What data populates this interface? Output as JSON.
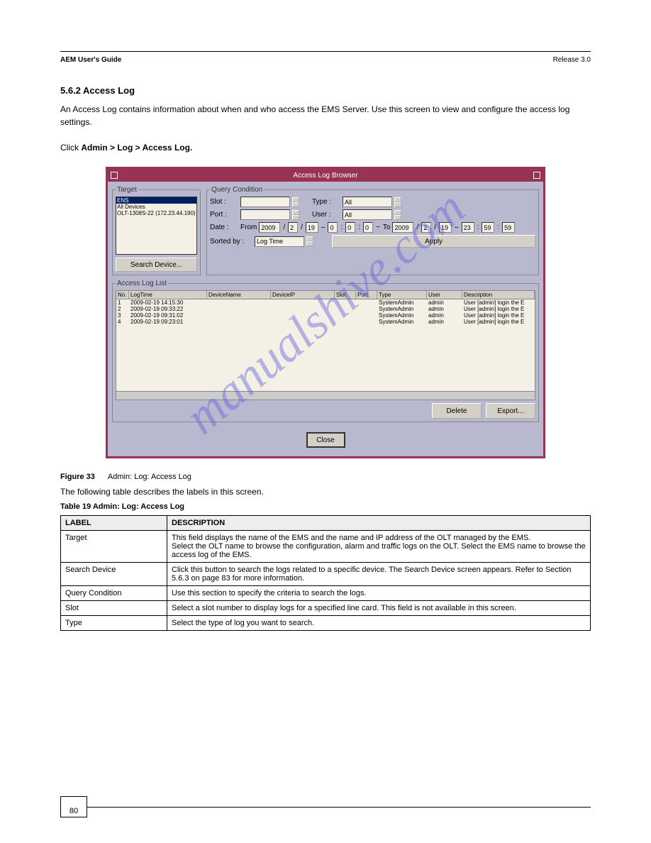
{
  "header": {
    "left": "AEM User's Guide",
    "right": "Release 3.0"
  },
  "section_title": "5.6.2 Access Log",
  "intro": "An Access Log contains information about when and who access the EMS Server. Use this screen to view and configure the access log settings.",
  "pathline_label": "Click ",
  "pathline_value": "Admin > Log > Access Log.",
  "win": {
    "title": "Access Log Browser"
  },
  "target": {
    "legend": "Target",
    "items": [
      "ENS",
      "All Devices",
      "OLT-1308S-22 (172.23.44.190)"
    ],
    "search_btn": "Search Device..."
  },
  "query": {
    "legend": "Query Condition",
    "slot_label": "Slot :",
    "port_label": "Port :",
    "type_label": "Type :",
    "type_value": "All",
    "user_label": "User :",
    "user_value": "All",
    "date_label": "Date :",
    "from_label": "From",
    "from": [
      "2009",
      "2",
      "19",
      "0",
      "0",
      "0"
    ],
    "to_label": "To",
    "to": [
      "2009",
      "2",
      "19",
      "23",
      "59",
      "59"
    ],
    "sorted_label": "Sorted by :",
    "sorted_value": "Log Time",
    "apply": "Apply"
  },
  "loglist": {
    "legend": "Access Log List",
    "cols": [
      "No.",
      "LogTime",
      "DeviceName",
      "DeviceIP",
      "Slot",
      "Port",
      "Type",
      "User",
      "Description"
    ],
    "rows": [
      {
        "no": "1",
        "lt": "2009-02-19 14:15:30",
        "ty": "SystemAdmin",
        "us": "admin",
        "de": "User [admin] login the E"
      },
      {
        "no": "2",
        "lt": "2009-02-19 09:33:22",
        "ty": "SystemAdmin",
        "us": "admin",
        "de": "User [admin] login the E"
      },
      {
        "no": "3",
        "lt": "2009-02-19 09:31:02",
        "ty": "SystemAdmin",
        "us": "admin",
        "de": "User [admin] login the E"
      },
      {
        "no": "4",
        "lt": "2009-02-19 09:23:01",
        "ty": "SystemAdmin",
        "us": "admin",
        "de": "User [admin] login the E"
      }
    ],
    "delete": "Delete",
    "export": "Export...",
    "close": "Close"
  },
  "caption": {
    "left": "Figure 33",
    "right": "Admin: Log: Access Log"
  },
  "table_head": "Table 19    Admin: Log: Access Log",
  "table": {
    "h1": "LABEL",
    "h2": "DESCRIPTION",
    "rows": [
      {
        "l": "Target",
        "d": "This field displays the name of the EMS and the name and IP address of the OLT managed by the EMS.\nSelect the OLT name to browse the configuration, alarm and traffic logs on the OLT. Select the EMS name to browse the access log of the EMS."
      },
      {
        "l": "Search Device",
        "d": "Click this button to search the logs related to a specific device. The Search Device screen appears. Refer to Section 5.6.3 on page 83 for more information."
      },
      {
        "l": "Query Condition",
        "d": "Use this section to specify the criteria to search the logs."
      },
      {
        "l": "Slot",
        "d": "Select a slot number to display logs for a specified line card. This field is not available in this screen."
      },
      {
        "l": "Type",
        "d": "Select the type of log you want to search."
      }
    ]
  },
  "watermark": "manualshive.com",
  "page_number": "80"
}
